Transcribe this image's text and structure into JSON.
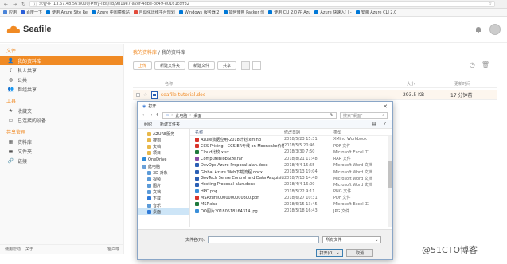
{
  "browser": {
    "security_label": "不安全",
    "url": "13.67.48.56:8000/#my-libs/lib/9b19e7-a2ef-4dbe-bc49-e0161ccff32",
    "bookmarks": [
      {
        "label": "应用",
        "color": "#4a84d8"
      },
      {
        "label": "百度一下",
        "color": "#2b5fd9"
      },
      {
        "label": "使用 Azure Site Re",
        "color": "#0078d7"
      },
      {
        "label": "Azure 中国镜像站",
        "color": "#0078d7"
      },
      {
        "label": "自动化运维平台规划",
        "color": "#e24b3b"
      },
      {
        "label": "Windows 服务器 2",
        "color": "#0078d7"
      },
      {
        "label": "如何使用 Packer 创",
        "color": "#0078d7"
      },
      {
        "label": "使用 CLI 2.0 在 Azu",
        "color": "#0078d7"
      },
      {
        "label": "Azure 快速入门 -",
        "color": "#0078d7"
      },
      {
        "label": "安装 Azure CLI 2.0",
        "color": "#0078d7"
      }
    ]
  },
  "header": {
    "logo_text": "Seafile",
    "accent": "#f08a24"
  },
  "sidebar": {
    "sections": [
      {
        "title": "文件",
        "items": [
          {
            "label": "我的资料库",
            "icon": "user-icon",
            "active": true
          },
          {
            "label": "私人共享",
            "icon": "share-icon",
            "active": false
          },
          {
            "label": "公共",
            "icon": "globe-icon",
            "active": false
          },
          {
            "label": "群组共享",
            "icon": "group-icon",
            "active": false
          }
        ]
      },
      {
        "title": "工具",
        "items": [
          {
            "label": "收藏夹",
            "icon": "star-icon",
            "active": false
          },
          {
            "label": "已连接的设备",
            "icon": "monitor-icon",
            "active": false
          }
        ]
      },
      {
        "title": "共享管理",
        "items": [
          {
            "label": "资料库",
            "icon": "library-icon",
            "active": false
          },
          {
            "label": "文件夹",
            "icon": "folder-icon",
            "active": false
          },
          {
            "label": "链接",
            "icon": "link-icon",
            "active": false
          }
        ]
      }
    ],
    "footer": {
      "help": "使用帮助",
      "about": "关于",
      "client": "客户端"
    }
  },
  "main": {
    "breadcrumb": {
      "root": "我的资料库",
      "sep": "/",
      "current": "我的资料库"
    },
    "toolbar": {
      "upload": "上传",
      "new_folder": "新建文件夹",
      "new_file": "新建文件",
      "share": "共享"
    },
    "columns": {
      "name": "名称",
      "size": "大小",
      "modified": "更新时间"
    },
    "files": [
      {
        "name": "seafile-tutorial.doc",
        "size": "293.5 KB",
        "modified": "17 分钟前"
      }
    ]
  },
  "dialog": {
    "title": "打开",
    "close": "✕",
    "path": [
      "此电脑",
      "桌面"
    ],
    "search_placeholder": "搜索\"桌面\"",
    "organize": "组织",
    "new_folder": "新建文件夹",
    "tree": [
      {
        "label": "AZURE服务",
        "color": "#e8b84a",
        "sub": true,
        "selected": false
      },
      {
        "label": "搜狗",
        "color": "#e8b84a",
        "sub": true,
        "selected": false
      },
      {
        "label": "文档",
        "color": "#e8b84a",
        "sub": true,
        "selected": false
      },
      {
        "label": "项目",
        "color": "#e8b84a",
        "sub": true,
        "selected": false
      },
      {
        "label": "OneDrive",
        "color": "#2f8ad8",
        "sub": false,
        "selected": false
      },
      {
        "label": "此电脑",
        "color": "#6aa0d8",
        "sub": false,
        "selected": false
      },
      {
        "label": "3D 对象",
        "color": "#5c9bd8",
        "sub": true,
        "selected": false
      },
      {
        "label": "视频",
        "color": "#5c9bd8",
        "sub": true,
        "selected": false
      },
      {
        "label": "图片",
        "color": "#5c9bd8",
        "sub": true,
        "selected": false
      },
      {
        "label": "文档",
        "color": "#5c9bd8",
        "sub": true,
        "selected": false
      },
      {
        "label": "下载",
        "color": "#2f7ad8",
        "sub": true,
        "selected": false
      },
      {
        "label": "音乐",
        "color": "#5c9bd8",
        "sub": true,
        "selected": false
      },
      {
        "label": "桌面",
        "color": "#2f7ad8",
        "sub": true,
        "selected": true
      }
    ],
    "columns": {
      "name": "名称",
      "date": "修改日期",
      "type": "类型"
    },
    "files": [
      {
        "name": "Azure数据应用-2018计划.xmind",
        "date": "2018/5/23 15:31",
        "type": "XMind Workbook",
        "color": "#d9342b"
      },
      {
        "name": "CCS Pricing - CCS ER专线 on Mooncake价格...",
        "date": "2018/5/5 20:46",
        "type": "PDF 文件",
        "color": "#d9342b"
      },
      {
        "name": "Cloud比较.xlsx",
        "date": "2018/3/30 7:50",
        "type": "Microsoft Excel 工",
        "color": "#1f7a3d"
      },
      {
        "name": "ComputeBlobSize.rar",
        "date": "2018/8/21 11:48",
        "type": "RAR 文件",
        "color": "#8a4ca8"
      },
      {
        "name": "DevOps-Azure-Proposal-alan.docx",
        "date": "2018/4/4 15:55",
        "type": "Microsoft Word 文档",
        "color": "#2b5fb4"
      },
      {
        "name": "Global Azure Web下载流程.docx",
        "date": "2018/5/13 19:04",
        "type": "Microsoft Word 文档",
        "color": "#2b5fb4"
      },
      {
        "name": "GovTech Sense Control and Data Acquisiti...",
        "date": "2018/7/13 14:48",
        "type": "Microsoft Word 文档",
        "color": "#2b5fb4"
      },
      {
        "name": "Hosting Proposal-alan.docx",
        "date": "2018/4/4 16:00",
        "type": "Microsoft Word 文档",
        "color": "#2b5fb4"
      },
      {
        "name": "HPC.png",
        "date": "2018/5/22 9:11",
        "type": "PNG 文件",
        "color": "#3a8fd9"
      },
      {
        "name": "MSAzure0000000000300.pdf",
        "date": "2018/6/27 10:31",
        "type": "PDF 文件",
        "color": "#d9342b"
      },
      {
        "name": "MSP.xlsx",
        "date": "2018/6/15 13:45",
        "type": "Microsoft Excel 工",
        "color": "#1f7a3d"
      },
      {
        "name": "OO图片20180518164314.jpg",
        "date": "2018/5/18 16:43",
        "type": "JPG 文件",
        "color": "#3a8fd9"
      }
    ],
    "filename_label": "文件名(N):",
    "filter": "所有文件",
    "open": "打开(O)",
    "cancel": "取消"
  },
  "watermark": "@51CTO博客"
}
